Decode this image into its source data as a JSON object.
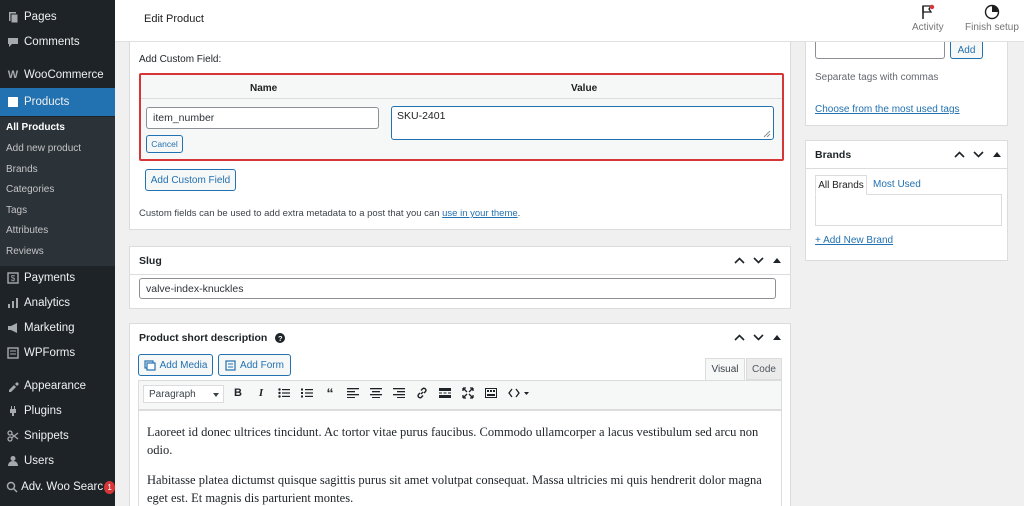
{
  "sidebar": {
    "top_items": [
      {
        "label": "Pages",
        "icon": "pages-icon"
      },
      {
        "label": "Comments",
        "icon": "comments-icon"
      },
      {
        "label": "WooCommerce",
        "icon": "woocommerce-icon"
      },
      {
        "label": "Products",
        "icon": "products-icon"
      }
    ],
    "submenu": [
      "All Products",
      "Add new product",
      "Brands",
      "Categories",
      "Tags",
      "Attributes",
      "Reviews"
    ],
    "bottom_items": [
      {
        "label": "Payments",
        "icon": "payments-icon"
      },
      {
        "label": "Analytics",
        "icon": "analytics-icon"
      },
      {
        "label": "Marketing",
        "icon": "marketing-icon"
      },
      {
        "label": "WPForms",
        "icon": "wpforms-icon"
      },
      {
        "label": "Appearance",
        "icon": "appearance-icon"
      },
      {
        "label": "Plugins",
        "icon": "plugins-icon"
      },
      {
        "label": "Snippets",
        "icon": "snippets-icon"
      },
      {
        "label": "Users",
        "icon": "users-icon"
      },
      {
        "label": "Adv. Woo Searc",
        "icon": "search-icon",
        "badge": "1"
      }
    ]
  },
  "header": {
    "title": "Edit Product",
    "activity_label": "Activity",
    "finish_setup_label": "Finish setup"
  },
  "custom_field": {
    "heading": "Add Custom Field:",
    "name_header": "Name",
    "value_header": "Value",
    "name_value": "item_number",
    "value_value": "SKU-2401",
    "cancel_label": "Cancel",
    "add_button_label": "Add Custom Field",
    "help_text": "Custom fields can be used to add extra metadata to a post that you can ",
    "help_link": "use in your theme",
    "help_end": "."
  },
  "slug": {
    "title": "Slug",
    "value": "valve-index-knuckles"
  },
  "short_description": {
    "title": "Product short description",
    "add_media_label": "Add Media",
    "add_form_label": "Add Form",
    "tab_visual": "Visual",
    "tab_code": "Code",
    "format_select": "Paragraph",
    "paragraphs": [
      "Laoreet id donec ultrices tincidunt. Ac tortor vitae purus faucibus. Commodo ullamcorper a lacus vestibulum sed arcu non odio.",
      "Habitasse platea dictumst quisque sagittis purus sit amet volutpat consequat. Massa ultricies mi quis hendrerit dolor magna eget est. Et magnis dis parturient montes."
    ]
  },
  "tags": {
    "add_label": "Add",
    "separate_hint": "Separate tags with commas",
    "choose_link": "Choose from the most used tags"
  },
  "brands": {
    "title": "Brands",
    "tab_all": "All Brands",
    "tab_most_used": "Most Used",
    "add_new_link": "+ Add New Brand"
  },
  "colors": {
    "sidebar_bg": "#1d2327",
    "active_blue": "#2271b1",
    "highlight_red": "#d63638"
  }
}
